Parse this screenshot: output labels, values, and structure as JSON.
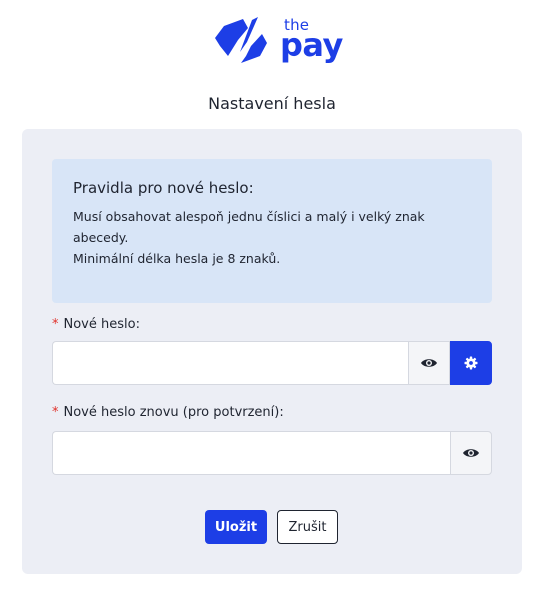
{
  "brand": {
    "logo_the": "the",
    "logo_pay": "pay",
    "color": "#1d3ee6"
  },
  "page_title": "Nastavení hesla",
  "rules": {
    "title": "Pravidla pro nové heslo:",
    "lines": [
      "Musí obsahovat alespoň jednu číslici a malý i velký znak",
      "abecedy.",
      "Minimální délka hesla je 8 znaků."
    ]
  },
  "form": {
    "required_marker": "*",
    "new_password": {
      "label": "Nové heslo:",
      "value": "",
      "icons": [
        "eye-icon",
        "gear-icon"
      ]
    },
    "confirm_password": {
      "label": "Nové heslo znovu (pro potvrzení):",
      "value": "",
      "icons": [
        "eye-icon"
      ]
    }
  },
  "actions": {
    "save_label": "Uložit",
    "cancel_label": "Zrušit"
  },
  "colors": {
    "accent": "#1d3ee6",
    "card_background": "#eceef5",
    "info_background": "#d8e5f7",
    "required": "#e0302a"
  }
}
